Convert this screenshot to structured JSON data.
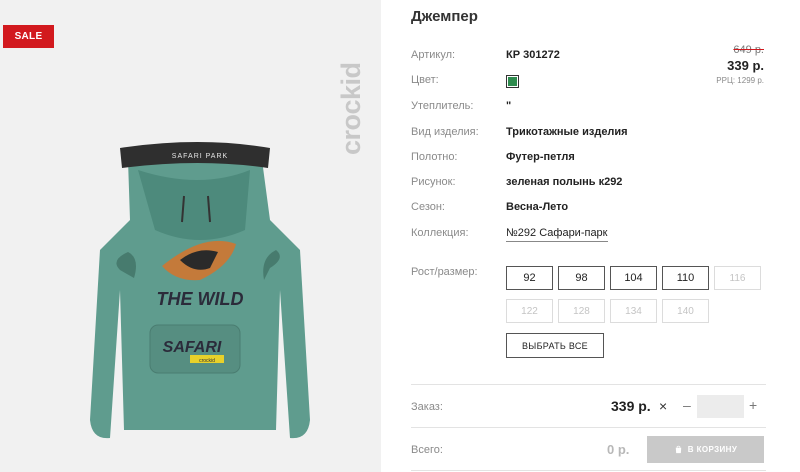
{
  "badge": {
    "sale": "SALE"
  },
  "brand": {
    "logo_text": "crockid"
  },
  "product": {
    "title": "Джемпер",
    "image_texts": {
      "hood_band": "SAFARI PARK",
      "main": "THE WILD",
      "pocket": "SAFARI",
      "pocket_tag": "crockid"
    },
    "attributes": [
      {
        "label": "Артикул:",
        "value": "КР 301272"
      },
      {
        "label": "Цвет:",
        "value": ""
      },
      {
        "label": "Утеплитель:",
        "value": "\""
      },
      {
        "label": "Вид изделия:",
        "value": "Трикотажные изделия"
      },
      {
        "label": "Полотно:",
        "value": "Футер-петля"
      },
      {
        "label": "Рисунок:",
        "value": "зеленая полынь к292"
      },
      {
        "label": "Сезон:",
        "value": "Весна-Лето"
      },
      {
        "label": "Коллекция:",
        "value": "№292 Сафари-парк"
      }
    ],
    "color_hex": "#2e8b4e"
  },
  "price": {
    "old": "649 р.",
    "new": "339 р.",
    "rrp": "РРЦ: 1299 р."
  },
  "sizes": {
    "label": "Рост/размер:",
    "options": [
      {
        "label": "92",
        "available": true
      },
      {
        "label": "98",
        "available": true
      },
      {
        "label": "104",
        "available": true
      },
      {
        "label": "110",
        "available": true
      },
      {
        "label": "116",
        "available": false
      },
      {
        "label": "122",
        "available": false
      },
      {
        "label": "128",
        "available": false
      },
      {
        "label": "134",
        "available": false
      },
      {
        "label": "140",
        "available": false
      }
    ],
    "select_all": "ВЫБРАТЬ ВСЕ"
  },
  "order": {
    "label": "Заказ:",
    "price": "339 р.",
    "clear_icon": "×",
    "minus": "–",
    "plus": "+",
    "quantity": ""
  },
  "total": {
    "label": "Всего:",
    "value": "0 р.",
    "cart_button": "В КОРЗИНУ"
  },
  "colors": {
    "sale": "#d2191e",
    "accent_green": "#2e8b4e",
    "garment": "#5f9c8e"
  }
}
